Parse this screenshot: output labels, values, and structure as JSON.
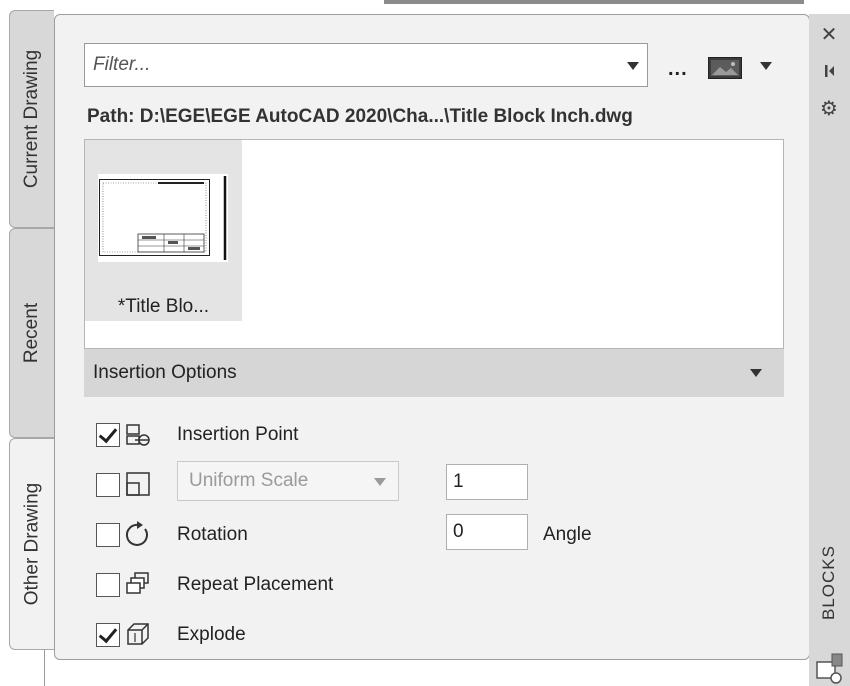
{
  "tabs": {
    "current_drawing": "Current Drawing",
    "recent": "Recent",
    "other_drawing": "Other Drawing"
  },
  "filter": {
    "placeholder": "Filter...",
    "value": ""
  },
  "toolbar": {
    "more_label": "...",
    "thumbnail_icon": "image-icon"
  },
  "path": "Path: D:\\EGE\\EGE AutoCAD 2020\\Cha...\\Title Block Inch.dwg",
  "blocks": [
    {
      "name": "*Title Blo..."
    }
  ],
  "insertion_options": {
    "title": "Insertion Options",
    "insertion_point": {
      "label": "Insertion Point",
      "checked": true
    },
    "scale": {
      "select_label": "Uniform Scale",
      "value": "1",
      "checked": false
    },
    "rotation": {
      "label": "Rotation",
      "value": "0",
      "unit_label": "Angle",
      "checked": false
    },
    "repeat_placement": {
      "label": "Repeat Placement",
      "checked": false
    },
    "explode": {
      "label": "Explode",
      "checked": true
    }
  },
  "sidebar": {
    "title": "BLOCKS",
    "close_icon": "close-icon",
    "pin_icon": "auto-hide-icon",
    "settings_icon": "gear-icon"
  }
}
